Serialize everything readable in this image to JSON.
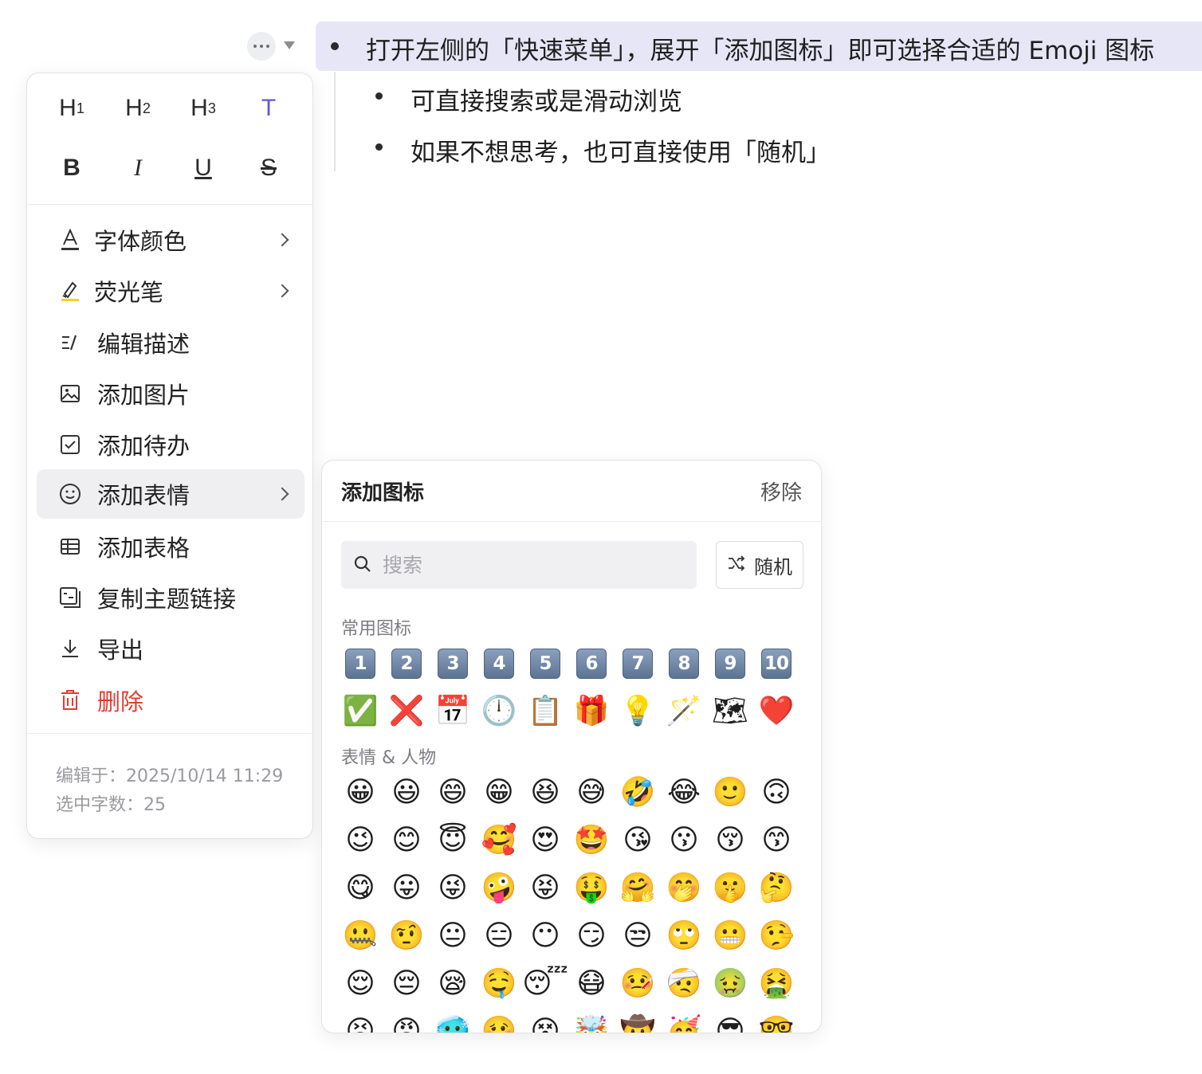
{
  "document": {
    "bullets": [
      {
        "text": "打开左侧的「快速菜单」，展开「添加图标」即可选择合适的 Emoji 图标"
      },
      {
        "text": "可直接搜索或是滑动浏览"
      },
      {
        "text": "如果不想思考，也可直接使用「随机」"
      }
    ]
  },
  "menu": {
    "format_row1": [
      "H",
      "H",
      "H",
      "T"
    ],
    "format_row1_sub": [
      "1",
      "2",
      "3",
      ""
    ],
    "format_row2": [
      "B",
      "I",
      "U",
      "S"
    ],
    "items": [
      {
        "label": "字体颜色",
        "icon": "font-color-icon",
        "submenu": true
      },
      {
        "label": "荧光笔",
        "icon": "highlighter-icon",
        "submenu": true
      },
      {
        "label": "编辑描述",
        "icon": "edit-description-icon",
        "submenu": false
      },
      {
        "label": "添加图片",
        "icon": "image-icon",
        "submenu": false
      },
      {
        "label": "添加待办",
        "icon": "checkbox-icon",
        "submenu": false
      },
      {
        "label": "添加表情",
        "icon": "smiley-icon",
        "submenu": true,
        "active": true
      },
      {
        "label": "添加表格",
        "icon": "table-icon",
        "submenu": false
      },
      {
        "label": "复制主题链接",
        "icon": "copy-link-icon",
        "submenu": false
      },
      {
        "label": "导出",
        "icon": "export-icon",
        "submenu": false
      },
      {
        "label": "删除",
        "icon": "trash-icon",
        "submenu": false,
        "danger": true
      }
    ],
    "meta": {
      "edited": "编辑于：2025/10/14 11:29",
      "selected_count": "选中字数：25"
    }
  },
  "emoji_panel": {
    "title": "添加图标",
    "remove_label": "移除",
    "search_placeholder": "搜索",
    "random_label": "随机",
    "sections": [
      {
        "title": "常用图标"
      },
      {
        "title": "表情 & 人物"
      }
    ],
    "keycaps": [
      "1",
      "2",
      "3",
      "4",
      "5",
      "6",
      "7",
      "8",
      "9",
      "10"
    ],
    "common_icons": [
      "✅",
      "❌",
      "📅",
      "🕛",
      "📋",
      "🎁",
      "💡",
      "🪄",
      "🗺",
      "❤️"
    ],
    "people_rows": [
      [
        "😀",
        "😃",
        "😄",
        "😁",
        "😆",
        "😅",
        "🤣",
        "😂",
        "🙂",
        "🙃"
      ],
      [
        "😉",
        "😊",
        "😇",
        "🥰",
        "😍",
        "🤩",
        "😘",
        "😗",
        "😚",
        "😙"
      ],
      [
        "😋",
        "😛",
        "😜",
        "🤪",
        "😝",
        "🤑",
        "🤗",
        "🤭",
        "🤫",
        "🤔"
      ],
      [
        "🤐",
        "🤨",
        "😐",
        "😑",
        "😶",
        "😏",
        "😒",
        "🙄",
        "😬",
        "🤥"
      ],
      [
        "😌",
        "😔",
        "😪",
        "🤤",
        "😴",
        "😷",
        "🤒",
        "🤕",
        "🤢",
        "🤮"
      ],
      [
        "😣",
        "😡",
        "🥶",
        "🥴",
        "😵",
        "🤯",
        "🤠",
        "🥳",
        "😎",
        "🤓"
      ]
    ],
    "colors": {
      "accent": "#5b5bd6",
      "danger": "#e03c31",
      "highlight": "#e6e6f7"
    }
  }
}
